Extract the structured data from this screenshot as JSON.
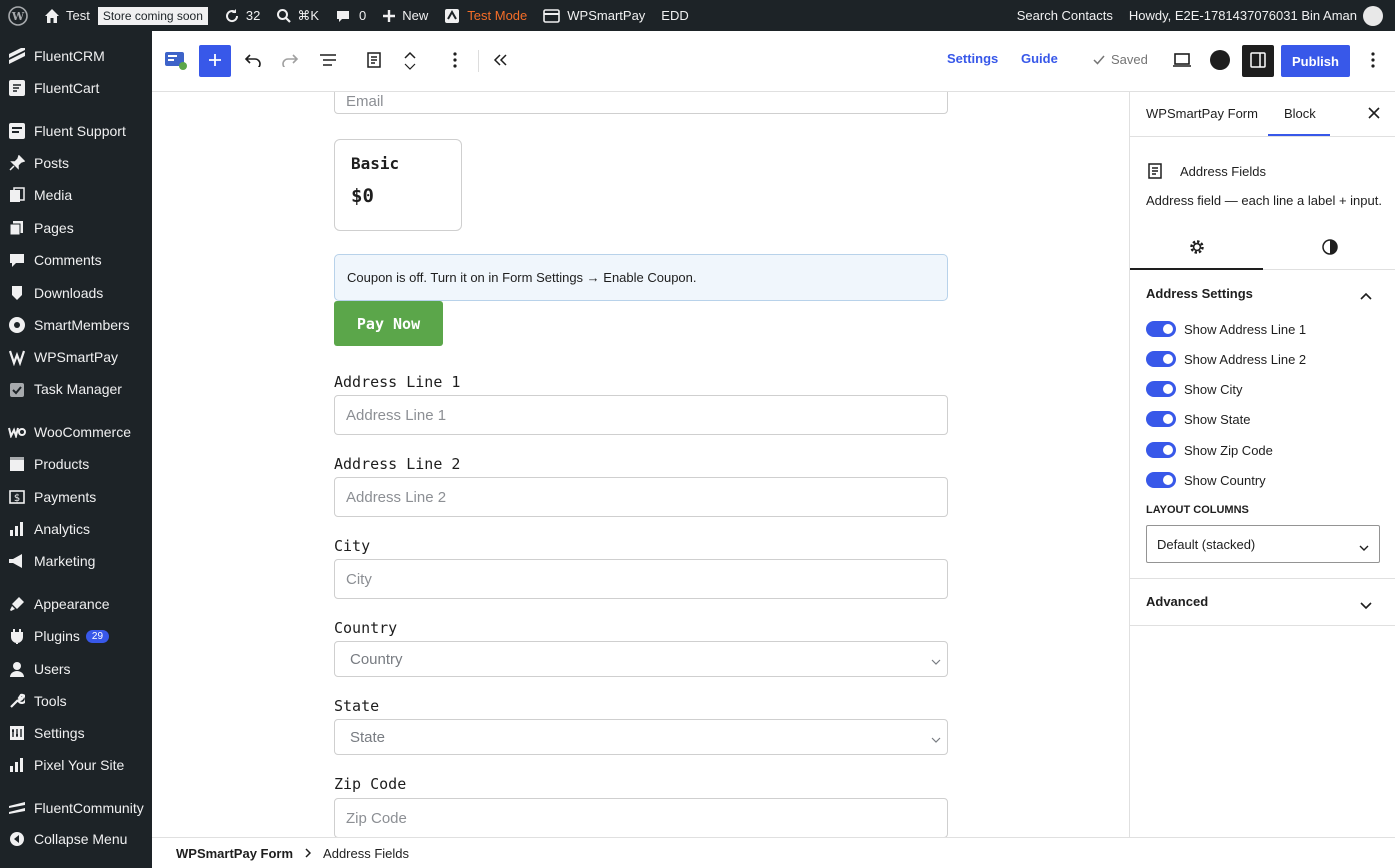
{
  "adminbar": {
    "site_name": "Test",
    "store_badge": "Store coming soon",
    "updates_count": "32",
    "search_shortcut": "⌘K",
    "comments_count": "0",
    "new_label": "New",
    "test_mode_label": "Test Mode",
    "wpsmartpay_label": "WPSmartPay",
    "edd_label": "EDD",
    "search_contacts": "Search Contacts",
    "howdy": "Howdy, E2E-1781437076031 Bin Aman"
  },
  "sidebar": {
    "items": [
      {
        "label": "FluentCRM",
        "icon": "fluentcrm-icon"
      },
      {
        "label": "FluentCart",
        "icon": "fluentcart-icon"
      },
      {
        "label": "Fluent Support",
        "icon": "fluent-support-icon"
      },
      {
        "label": "Posts",
        "icon": "pin-icon"
      },
      {
        "label": "Media",
        "icon": "media-icon"
      },
      {
        "label": "Pages",
        "icon": "pages-icon"
      },
      {
        "label": "Comments",
        "icon": "comments-icon"
      },
      {
        "label": "Downloads",
        "icon": "downloads-icon"
      },
      {
        "label": "SmartMembers",
        "icon": "smartmembers-icon"
      },
      {
        "label": "WPSmartPay",
        "icon": "wpsmartpay-icon"
      },
      {
        "label": "Task Manager",
        "icon": "task-icon"
      },
      {
        "label": "WooCommerce",
        "icon": "woo-icon"
      },
      {
        "label": "Products",
        "icon": "products-icon"
      },
      {
        "label": "Payments",
        "icon": "payments-icon"
      },
      {
        "label": "Analytics",
        "icon": "analytics-icon"
      },
      {
        "label": "Marketing",
        "icon": "marketing-icon"
      },
      {
        "label": "Appearance",
        "icon": "appearance-icon"
      },
      {
        "label": "Plugins",
        "icon": "plugins-icon",
        "badge": "29"
      },
      {
        "label": "Users",
        "icon": "users-icon"
      },
      {
        "label": "Tools",
        "icon": "tools-icon"
      },
      {
        "label": "Settings",
        "icon": "settings-icon"
      },
      {
        "label": "Pixel Your Site",
        "icon": "pixel-icon"
      },
      {
        "label": "FluentCommunity",
        "icon": "fluentcommunity-icon"
      },
      {
        "label": "Collapse Menu",
        "icon": "collapse-icon"
      }
    ]
  },
  "toolbar": {
    "settings_label": "Settings",
    "guide_label": "Guide",
    "saved_label": "Saved",
    "publish_label": "Publish"
  },
  "form": {
    "email_placeholder": "Email",
    "price_name": "Basic",
    "price_amount": "$0",
    "coupon_notice": "Coupon is off. Turn it on in Form Settings → Enable Coupon.",
    "pay_now_label": "Pay Now",
    "address_line1_label": "Address Line 1",
    "address_line1_placeholder": "Address Line 1",
    "address_line2_label": "Address Line 2",
    "address_line2_placeholder": "Address Line 2",
    "city_label": "City",
    "city_placeholder": "City",
    "country_label": "Country",
    "country_value": "Country",
    "state_label": "State",
    "state_value": "State",
    "zip_label": "Zip Code",
    "zip_placeholder": "Zip Code"
  },
  "breadcrumb": {
    "root": "WPSmartPay Form",
    "current": "Address Fields"
  },
  "panel": {
    "tab_form": "WPSmartPay Form",
    "tab_block": "Block",
    "block_title": "Address Fields",
    "block_desc": "Address field — each line a label + input.",
    "section_title": "Address Settings",
    "toggles": [
      {
        "label": "Show Address Line 1",
        "on": true
      },
      {
        "label": "Show Address Line 2",
        "on": true
      },
      {
        "label": "Show City",
        "on": true
      },
      {
        "label": "Show State",
        "on": true
      },
      {
        "label": "Show Zip Code",
        "on": true
      },
      {
        "label": "Show Country",
        "on": true
      }
    ],
    "layout_label": "Layout Columns",
    "layout_value": "Default (stacked)",
    "advanced_label": "Advanced"
  },
  "colors": {
    "accent": "#3858e9",
    "admin_bg": "#1d2327",
    "pay_button": "#5ba64a",
    "test_mode": "#f56e28"
  }
}
